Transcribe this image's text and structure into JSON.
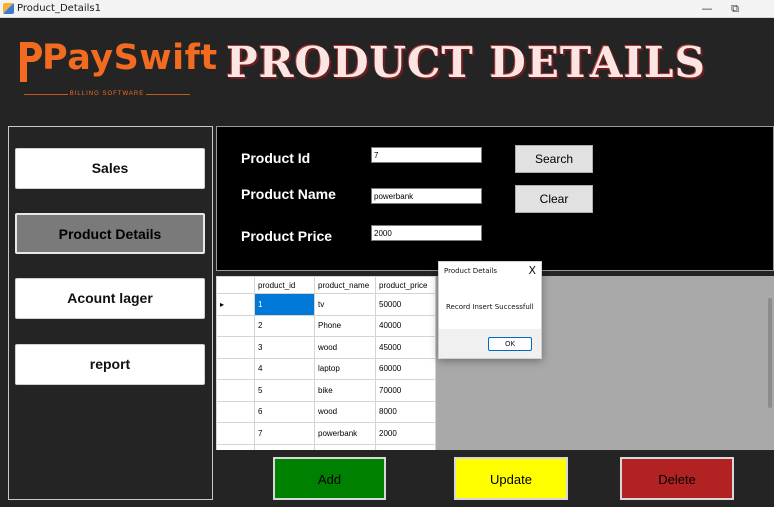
{
  "window": {
    "title": "Product_Details1",
    "minimize": "—",
    "restore": "⧉"
  },
  "logo": {
    "text": "PaySwift",
    "subtitle": "BILLING SOFTWARE",
    "accent": "#f26b21"
  },
  "header": {
    "title": "PRODUCT DETAILS"
  },
  "sidebar": {
    "items": [
      {
        "label": "Sales"
      },
      {
        "label": "Product Details",
        "active": true
      },
      {
        "label": "Acount lager"
      },
      {
        "label": "report"
      }
    ]
  },
  "form": {
    "product_id_label": "Product Id",
    "product_id_value": "7",
    "product_name_label": "Product Name",
    "product_name_value": "powerbank",
    "product_price_label": "Product Price",
    "product_price_value": "2000",
    "search_label": "Search",
    "clear_label": "Clear"
  },
  "grid": {
    "columns": [
      "product_id",
      "product_name",
      "product_price"
    ],
    "row_marker": "▸",
    "rows": [
      [
        "1",
        "tv",
        "50000"
      ],
      [
        "2",
        "Phone",
        "40000"
      ],
      [
        "3",
        "wood",
        "45000"
      ],
      [
        "4",
        "laptop",
        "60000"
      ],
      [
        "5",
        "bike",
        "70000"
      ],
      [
        "6",
        "wood",
        "8000"
      ],
      [
        "7",
        "powerbank",
        "2000"
      ]
    ]
  },
  "actions": {
    "add_label": "Add",
    "add_color": "#008000",
    "update_label": "Update",
    "update_color": "#ffff00",
    "delete_label": "Delete",
    "delete_color": "#b22222"
  },
  "dialog": {
    "title": "Product Details",
    "close": "X",
    "message": "Record Insert Successfull",
    "ok_label": "OK"
  }
}
